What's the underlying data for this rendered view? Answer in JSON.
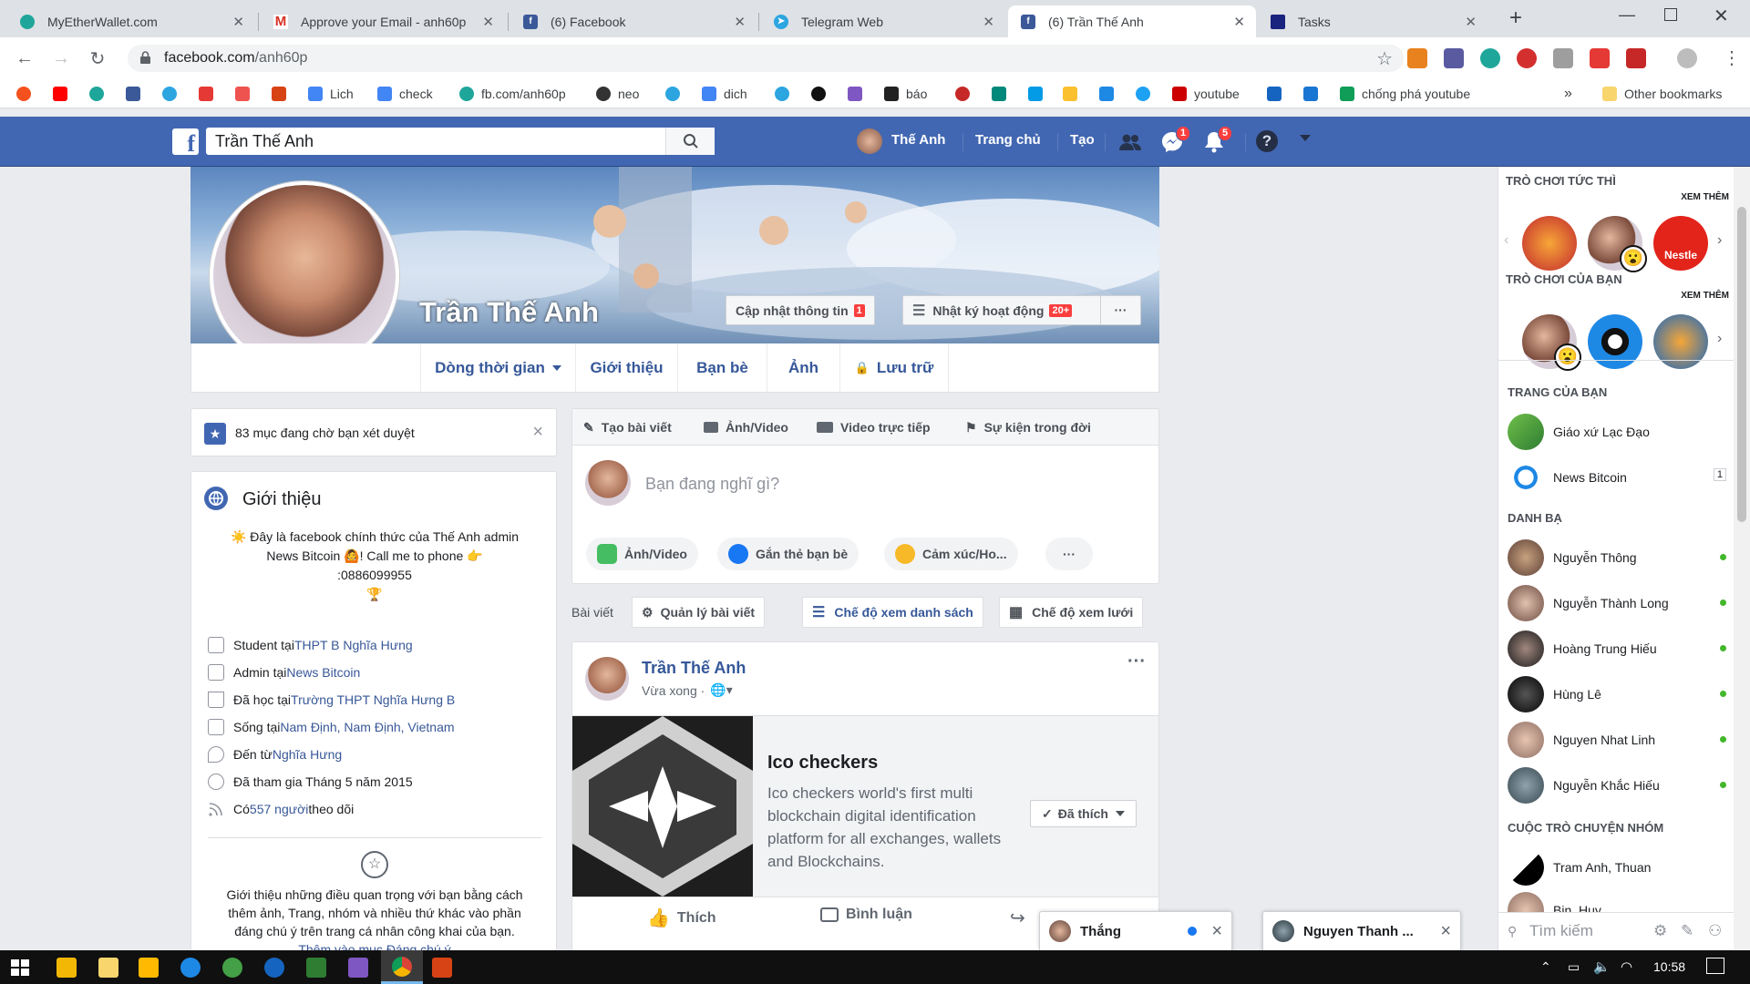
{
  "browser": {
    "tabs": [
      {
        "title": "MyEtherWallet.com",
        "color": "#1fa69a"
      },
      {
        "title": "Approve your Email - anh60p",
        "color": "#ffffff"
      },
      {
        "title": "(6) Facebook",
        "color": "#3b5998"
      },
      {
        "title": "Telegram Web",
        "color": "#2ca5e0"
      },
      {
        "title": "(6) Trần Thế Anh",
        "color": "#3b5998"
      },
      {
        "title": "Tasks",
        "color": "#1a237e"
      }
    ],
    "new_tab": "+",
    "url_host": "facebook.com",
    "url_path": "/anh60p",
    "bookmarks": [
      {
        "label": "Lich",
        "color": "#4285f4"
      },
      {
        "label": "check",
        "color": "#4285f4"
      },
      {
        "label": "fb.com/anh60p",
        "color": "#1fa69a"
      },
      {
        "label": "neo",
        "color": "#333333"
      },
      {
        "label": "dich",
        "color": "#4285f4"
      },
      {
        "label": "báo",
        "color": "#222222"
      },
      {
        "label": "youtube",
        "color": "#cc0000"
      },
      {
        "label": "chống phá youtube",
        "color": "#0f9d58"
      }
    ],
    "more_bookmarks": "»",
    "other_bookmarks": "Other bookmarks"
  },
  "fb": {
    "search_value": "Trần Thế Anh",
    "nav_user": "Thế Anh",
    "nav_home": "Trang chủ",
    "nav_create": "Tạo",
    "messages_badge": "1",
    "notif_badge": "5",
    "help": "?"
  },
  "profile": {
    "name": "Trần Thế Anh",
    "update_info": "Cập nhật thông tin",
    "update_badge": "1",
    "activity_log": "Nhật ký hoạt động",
    "activity_badge": "20+",
    "more": "···",
    "tabs": [
      "Dòng thời gian",
      "Giới thiệu",
      "Bạn bè",
      "Ảnh",
      "Lưu trữ"
    ]
  },
  "pending": {
    "text": "83 mục đang chờ bạn xét duyệt",
    "close": "×"
  },
  "intro": {
    "title": "Giới thiệu",
    "bio_line1": "Đây là facebook chính thức của Thế Anh admin",
    "bio_line2": "News Bitcoin",
    "bio_line3": "! Call me to phone",
    "bio_line4": ":0886099955",
    "rows": [
      {
        "pre": "Student tại ",
        "link": "THPT B Nghĩa Hưng",
        "post": ""
      },
      {
        "pre": "Admin tại ",
        "link": "News Bitcoin",
        "post": ""
      },
      {
        "pre": "Đã học tại ",
        "link": "Trường THPT Nghĩa Hưng B",
        "post": ""
      },
      {
        "pre": "Sống tại ",
        "link": "Nam Định, Nam Định, Vietnam",
        "post": ""
      },
      {
        "pre": "Đến từ ",
        "link": "Nghĩa Hưng",
        "post": ""
      },
      {
        "pre": "Đã tham gia Tháng 5 năm 2015",
        "link": "",
        "post": ""
      },
      {
        "pre": "Có ",
        "link": "557 người",
        "post": " theo dõi"
      }
    ],
    "featured_line1": "Giới thiệu những điều quan trọng với bạn bằng cách",
    "featured_line2": "thêm ảnh, Trang, nhóm và nhiều thứ khác vào phần",
    "featured_line3": "đáng chú ý trên trang cá nhân công khai của bạn.",
    "featured_link": "Thêm vào mục Đáng chú ý"
  },
  "composer": {
    "tabs": [
      "Tạo bài viết",
      "Ảnh/Video",
      "Video trực tiếp",
      "Sự kiện trong đời"
    ],
    "placeholder": "Bạn đang nghĩ gì?",
    "pills": [
      "Ảnh/Video",
      "Gắn thẻ bạn bè",
      "Cảm xúc/Ho..."
    ],
    "more": "···"
  },
  "posts_bar": {
    "label": "Bài viết",
    "manage": "Quản lý bài viết",
    "list_view": "Chế độ xem danh sách",
    "grid_view": "Chế độ xem lưới"
  },
  "post": {
    "author": "Trần Thế Anh",
    "time": "Vừa xong ·",
    "more": "···",
    "page_title": "Ico checkers",
    "page_desc": [
      "Ico checkers world's first multi",
      "blockchain digital identification",
      "platform for all exchanges, wallets",
      "and Blockchains."
    ],
    "liked_btn": "Đã thích",
    "like": "Thích",
    "comment": "Bình luận"
  },
  "sidebar": {
    "instant_games": "TRÒ CHƠI TỨC THÌ",
    "see_more": "XEM THÊM",
    "your_games": "TRÒ CHƠI CỦA BẠN",
    "nestle": "Nestle",
    "your_pages": "TRANG CỦA BẠN",
    "pages": [
      {
        "name": "Giáo xứ Lạc Đạo",
        "count": ""
      },
      {
        "name": "News Bitcoin",
        "count": "1"
      }
    ],
    "contacts_title": "DANH BẠ",
    "contacts": [
      {
        "name": "Nguyễn Thông"
      },
      {
        "name": "Nguyễn Thành Long"
      },
      {
        "name": "Hoàng Trung Hiếu"
      },
      {
        "name": "Hùng Lê"
      },
      {
        "name": "Nguyen Nhat Linh"
      },
      {
        "name": "Nguyễn Khắc Hiếu"
      }
    ],
    "groups_title": "CUỘC TRÒ CHUYỆN NHÓM",
    "group_first": "Tram Anh, Thuan",
    "group_second": "Bin, Huy",
    "search_placeholder": "Tìm kiếm"
  },
  "chats": [
    {
      "name": "Thắng",
      "close": "×"
    },
    {
      "name": "Nguyen Thanh ...",
      "close": "×"
    }
  ],
  "taskbar": {
    "time": "10:58"
  }
}
